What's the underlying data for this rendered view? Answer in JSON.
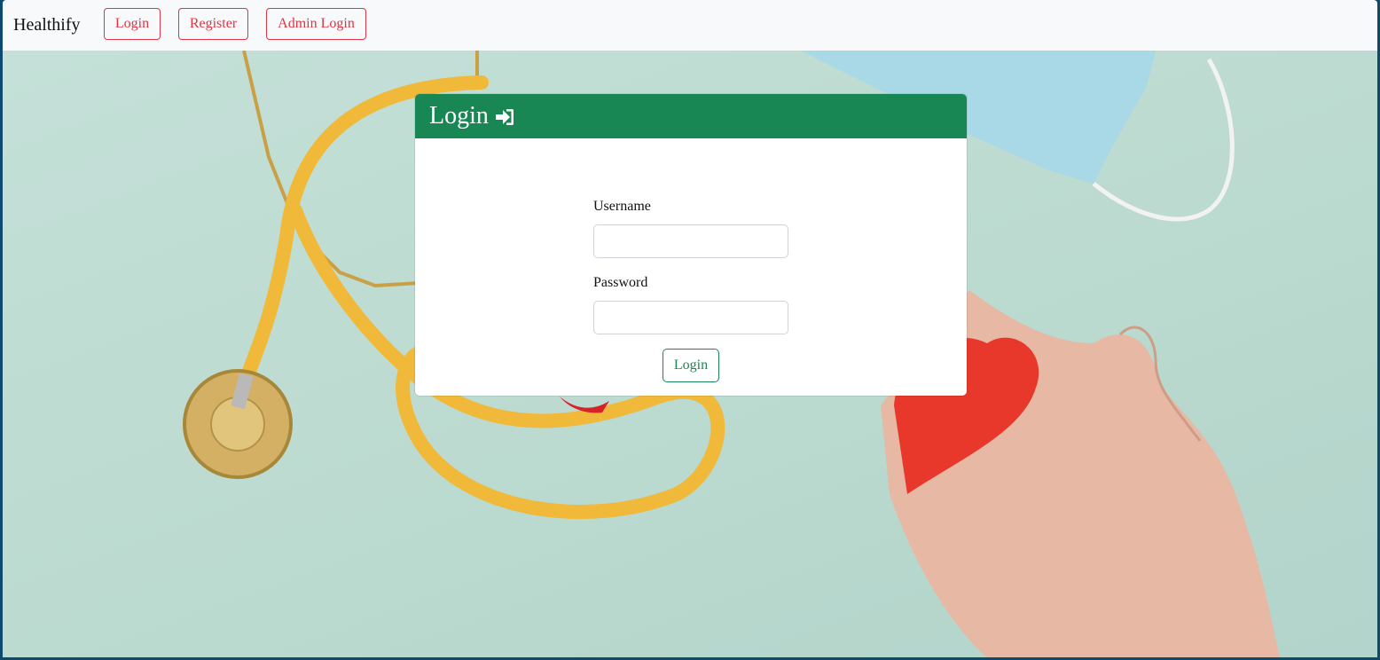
{
  "navbar": {
    "brand": "Healthify",
    "login_label": "Login",
    "register_label": "Register",
    "admin_login_label": "Admin Login"
  },
  "card": {
    "title": "Login",
    "title_icon": "sign-in-icon",
    "username_label": "Username",
    "username_value": "",
    "password_label": "Password",
    "password_value": "",
    "submit_label": "Login"
  },
  "colors": {
    "navbar_bg": "#f8f9fa",
    "nav_button": "#dc3545",
    "card_header": "#198754",
    "submit_button": "#198754"
  }
}
